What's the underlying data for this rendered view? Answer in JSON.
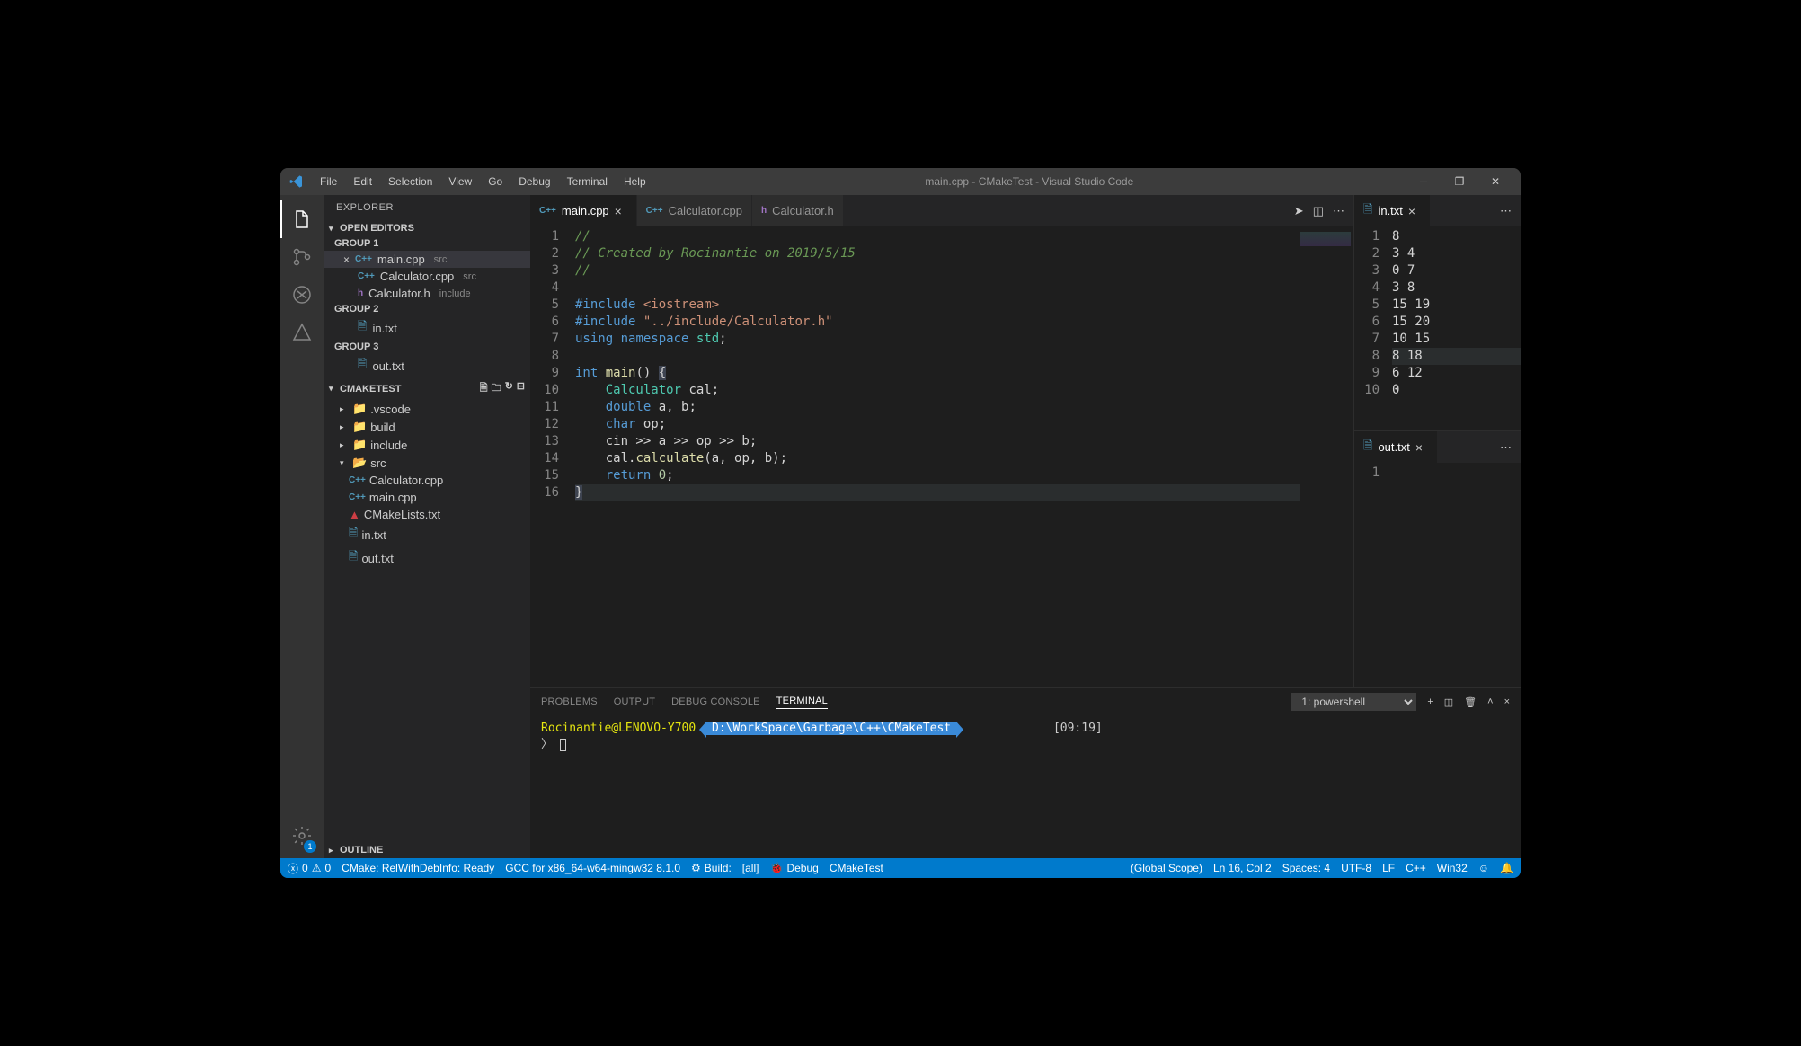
{
  "window": {
    "title": "main.cpp - CMakeTest - Visual Studio Code"
  },
  "menu": [
    "File",
    "Edit",
    "Selection",
    "View",
    "Go",
    "Debug",
    "Terminal",
    "Help"
  ],
  "explorer": {
    "title": "EXPLORER",
    "openEditors": "OPEN EDITORS",
    "groups": {
      "g1": "GROUP 1",
      "g2": "GROUP 2",
      "g3": "GROUP 3"
    },
    "files": {
      "main": {
        "name": "main.cpp",
        "dir": "src"
      },
      "calc_cpp": {
        "name": "Calculator.cpp",
        "dir": "src"
      },
      "calc_h": {
        "name": "Calculator.h",
        "dir": "include"
      },
      "in": {
        "name": "in.txt"
      },
      "out": {
        "name": "out.txt"
      }
    },
    "project": "CMAKETEST",
    "tree": {
      "vscode": ".vscode",
      "build": "build",
      "include": "include",
      "src": "src",
      "calc_cpp": "Calculator.cpp",
      "main": "main.cpp",
      "cmakelists": "CMakeLists.txt",
      "in": "in.txt",
      "out": "out.txt"
    },
    "outline": "OUTLINE"
  },
  "tabs": {
    "main": "main.cpp",
    "calc": "Calculator.cpp",
    "calc_h": "Calculator.h",
    "in": "in.txt",
    "out": "out.txt"
  },
  "code": {
    "l1": "//",
    "l2": "// Created by Rocinantie on 2019/5/15",
    "l3": "//",
    "l4": "",
    "l5_a": "#include",
    "l5_b": " <iostream>",
    "l6_a": "#include",
    "l6_b": " \"../include/Calculator.h\"",
    "l7_a": "using",
    "l7_b": " namespace",
    "l7_c": " std",
    "l7_d": ";",
    "l8": "",
    "l9_a": "int",
    "l9_b": " main",
    "l9_c": "() ",
    "l9_d": "{",
    "l10_a": "    Calculator",
    "l10_b": " cal;",
    "l11_a": "    double",
    "l11_b": " a, b;",
    "l12_a": "    char",
    "l12_b": " op;",
    "l13": "    cin >> a >> op >> b;",
    "l14_a": "    cal.",
    "l14_b": "calculate",
    "l14_c": "(a, op, b);",
    "l15_a": "    return ",
    "l15_b": "0",
    "l15_c": ";",
    "l16": "}"
  },
  "in_txt": [
    "8",
    "3 4",
    "0 7",
    "3 8",
    "15 19",
    "15 20",
    "10 15",
    "8 18",
    "6 12",
    "0"
  ],
  "out_txt": [
    ""
  ],
  "panel": {
    "tabs": {
      "problems": "PROBLEMS",
      "output": "OUTPUT",
      "debug": "DEBUG CONSOLE",
      "terminal": "TERMINAL"
    },
    "term_name": "1: powershell",
    "prompt_user": "Rocinantie@LENOVO-Y700",
    "prompt_path": "D:\\WorkSpace\\Garbage\\C++\\CMakeTest",
    "time": "[09:19]",
    "prompt2": "〉"
  },
  "status": {
    "errors": "0",
    "warnings": "0",
    "cmake": "CMake: RelWithDebInfo: Ready",
    "gcc": "GCC for x86_64-w64-mingw32 8.1.0",
    "build": "Build:",
    "build_target": "[all]",
    "debug": "Debug",
    "proj": "CMakeTest",
    "scope": "(Global Scope)",
    "pos": "Ln 16, Col 2",
    "spaces": "Spaces: 4",
    "enc": "UTF-8",
    "eol": "LF",
    "lang": "C++",
    "os": "Win32"
  }
}
